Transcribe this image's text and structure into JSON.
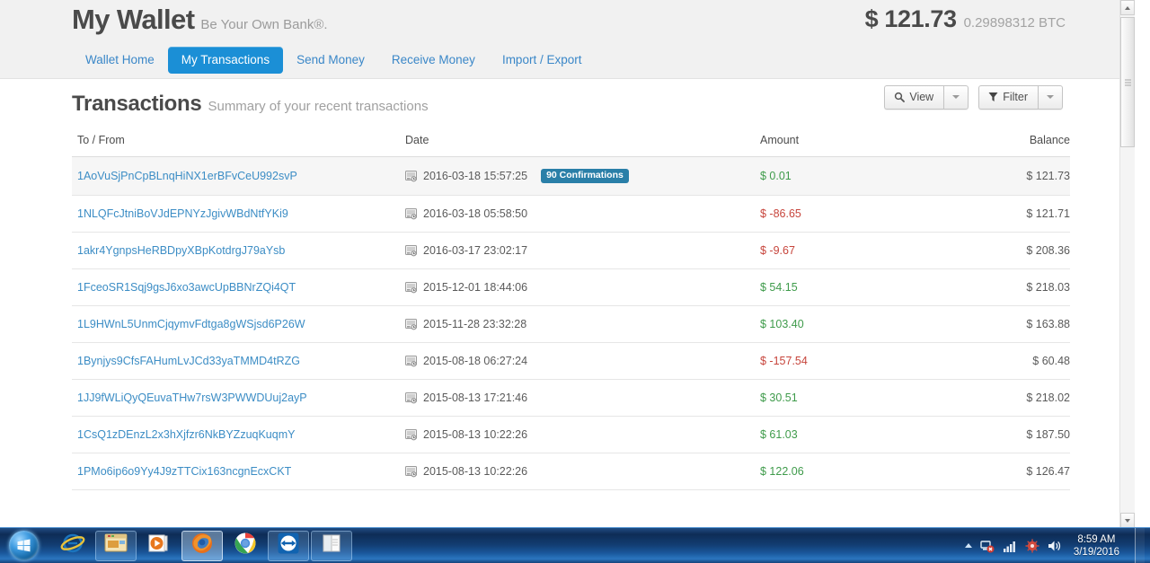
{
  "header": {
    "brand_title": "My Wallet",
    "brand_tagline": "Be Your Own Bank®.",
    "balance_fiat": "$ 121.73",
    "balance_btc": "0.29898312 BTC"
  },
  "nav": {
    "tabs": [
      {
        "label": "Wallet Home",
        "active": false
      },
      {
        "label": "My Transactions",
        "active": true
      },
      {
        "label": "Send Money",
        "active": false
      },
      {
        "label": "Receive Money",
        "active": false
      },
      {
        "label": "Import / Export",
        "active": false
      }
    ]
  },
  "page": {
    "title": "Transactions",
    "subtitle": "Summary of your recent transactions"
  },
  "toolbar": {
    "view_label": "View",
    "view_icon": "magnifier-icon",
    "filter_label": "Filter",
    "filter_icon": "funnel-icon",
    "caret_icon": "chevron-down-icon"
  },
  "table": {
    "columns": [
      "To / From",
      "Date",
      "Amount",
      "Balance"
    ],
    "date_icon": "transaction-record-icon",
    "rows": [
      {
        "address": "1AoVuSjPnCpBLnqHiNX1erBFvCeU992svP",
        "date": "2016-03-18 15:57:25",
        "badge": "90 Confirmations",
        "amount": "$ 0.01",
        "amount_sign": "positive",
        "balance": "$ 121.73",
        "highlighted": true
      },
      {
        "address": "1NLQFcJtniBoVJdEPNYzJgivWBdNtfYKi9",
        "date": "2016-03-18 05:58:50",
        "badge": "",
        "amount": "$ -86.65",
        "amount_sign": "negative",
        "balance": "$ 121.71",
        "highlighted": false
      },
      {
        "address": "1akr4YgnpsHeRBDpyXBpKotdrgJ79aYsb",
        "date": "2016-03-17 23:02:17",
        "badge": "",
        "amount": "$ -9.67",
        "amount_sign": "negative",
        "balance": "$ 208.36",
        "highlighted": false
      },
      {
        "address": "1FceoSR1Sqj9gsJ6xo3awcUpBBNrZQi4QT",
        "date": "2015-12-01 18:44:06",
        "badge": "",
        "amount": "$ 54.15",
        "amount_sign": "positive",
        "balance": "$ 218.03",
        "highlighted": false
      },
      {
        "address": "1L9HWnL5UnmCjqymvFdtga8gWSjsd6P26W",
        "date": "2015-11-28 23:32:28",
        "badge": "",
        "amount": "$ 103.40",
        "amount_sign": "positive",
        "balance": "$ 163.88",
        "highlighted": false
      },
      {
        "address": "1Bynjys9CfsFAHumLvJCd33yaTMMD4tRZG",
        "date": "2015-08-18 06:27:24",
        "badge": "",
        "amount": "$ -157.54",
        "amount_sign": "negative",
        "balance": "$ 60.48",
        "highlighted": false
      },
      {
        "address": "1JJ9fWLiQyQEuvaTHw7rsW3PWWDUuj2ayP",
        "date": "2015-08-13 17:21:46",
        "badge": "",
        "amount": "$ 30.51",
        "amount_sign": "positive",
        "balance": "$ 218.02",
        "highlighted": false
      },
      {
        "address": "1CsQ1zDEnzL2x3hXjfzr6NkBYZzuqKuqmY",
        "date": "2015-08-13 10:22:26",
        "badge": "",
        "amount": "$ 61.03",
        "amount_sign": "positive",
        "balance": "$ 187.50",
        "highlighted": false
      },
      {
        "address": "1PMo6ip6o9Yy4J9zTTCix163ncgnEcxCKT",
        "date": "2015-08-13 10:22:26",
        "badge": "",
        "amount": "$ 122.06",
        "amount_sign": "positive",
        "balance": "$ 126.47",
        "highlighted": false
      }
    ]
  },
  "taskbar": {
    "start_label": "start-orb",
    "items": [
      {
        "name": "internet-explorer-icon",
        "state": "plain"
      },
      {
        "name": "windows-explorer-icon",
        "state": "pinned"
      },
      {
        "name": "windows-media-player-icon",
        "state": "plain"
      },
      {
        "name": "firefox-icon",
        "state": "active"
      },
      {
        "name": "google-chrome-icon",
        "state": "plain"
      },
      {
        "name": "teamviewer-icon",
        "state": "pinned"
      },
      {
        "name": "notepad-icon",
        "state": "pinned"
      }
    ],
    "tray": [
      "network-error-icon",
      "signal-bars-icon",
      "antivirus-icon",
      "volume-icon"
    ],
    "clock_time": "8:59 AM",
    "clock_date": "3/19/2016"
  },
  "colors": {
    "accent_blue": "#1b8fd6",
    "link_blue": "#3c8dc5",
    "badge_blue": "#2a7fa8",
    "positive_green": "#3f9b4b",
    "negative_red": "#c7453c"
  }
}
